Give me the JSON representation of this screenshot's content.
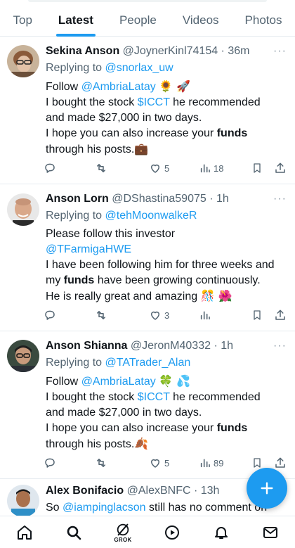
{
  "tabs": [
    "Top",
    "Latest",
    "People",
    "Videos",
    "Photos"
  ],
  "active_tab": "Latest",
  "tweets": [
    {
      "name": "Sekina Anson",
      "handle": "@JoynerKinl74154",
      "time": "36m",
      "reply_label": "Replying to",
      "reply_to": "@snorlax_uw",
      "line1_prefix": "Follow",
      "line1_link": "@AmbriaLatay",
      "line1_emoji": "🌻 🚀",
      "line2_prefix": "I bought the stock",
      "line2_link": "$ICCT",
      "line2_suffix": "he recommended",
      "line3": "and made $27,000 in two days.",
      "line4_prefix": "I hope you can also increase your",
      "line4_bold": "funds",
      "line5": "through his posts.",
      "line5_emoji": "💼",
      "likes": "5",
      "views": "18"
    },
    {
      "name": "Anson Lorn",
      "handle": "@DShastina59075",
      "time": "1h",
      "reply_label": "Replying to",
      "reply_to": "@tehMoonwalkeR",
      "line1": "Please follow this investor",
      "line2_link": "@TFarmigaHWE",
      "line3": "I have been following him for three weeks and",
      "line4_prefix": "my",
      "line4_bold": "funds",
      "line4_suffix": "have been growing continuously.",
      "line5": "He is really great and amazing",
      "line5_emoji": "🎊 🌺",
      "likes": "3",
      "views": ""
    },
    {
      "name": "Anson Shianna",
      "handle": "@JeronM40332",
      "time": "1h",
      "reply_label": "Replying to",
      "reply_to": "@TATrader_Alan",
      "line1_prefix": "Follow",
      "line1_link": "@AmbriaLatay",
      "line1_emoji": "🍀 💦",
      "line2_prefix": "I bought the stock",
      "line2_link": "$ICCT",
      "line2_suffix": "he recommended",
      "line3": "and made $27,000 in two days.",
      "line4_prefix": "I hope you can also increase your",
      "line4_bold": "funds",
      "line5": "through his posts.",
      "line5_emoji": "🍂",
      "likes": "5",
      "views": "89"
    },
    {
      "name": "Alex Bonifacio",
      "handle": "@AlexBNFC",
      "time": "13h",
      "line1_prefix": "So",
      "line1_link": "@iampinglacson",
      "line1_suffix": "still has no comment on"
    }
  ],
  "nav": {
    "grok_label": "GROK"
  },
  "colors": {
    "accent": "#1d9bf0",
    "text": "#0f1419",
    "muted": "#536471",
    "border": "#e6ecf0"
  },
  "icons": [
    "home-icon",
    "search-icon",
    "grok-icon",
    "play-icon",
    "bell-icon",
    "mail-icon",
    "reply-icon",
    "retweet-icon",
    "like-icon",
    "views-icon",
    "bookmark-icon",
    "share-icon",
    "compose-icon",
    "more-icon"
  ]
}
